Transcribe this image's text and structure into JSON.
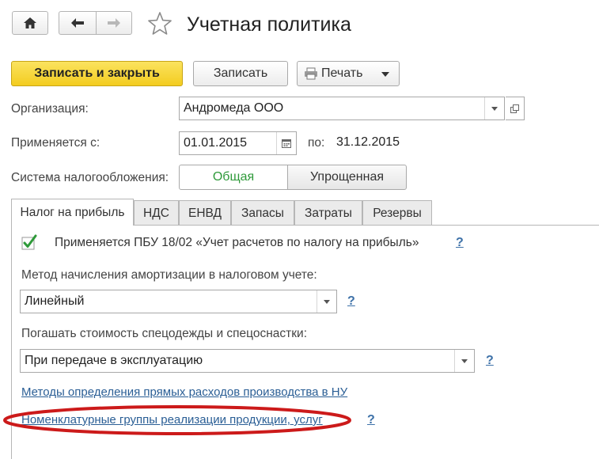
{
  "header": {
    "title": "Учетная политика"
  },
  "toolbar": {
    "save_close_label": "Записать и закрыть",
    "save_label": "Записать",
    "print_label": "Печать"
  },
  "form": {
    "org_label": "Организация:",
    "org_value": "Андромеда ООО",
    "applies_label": "Применяется с:",
    "date_from": "01.01.2015",
    "to_label": "по:",
    "date_to": "31.12.2015",
    "tax_system_label": "Система налогообложения:",
    "tax_options": [
      "Общая",
      "Упрощенная"
    ]
  },
  "tabs": [
    "Налог на прибыль",
    "НДС",
    "ЕНВД",
    "Запасы",
    "Затраты",
    "Резервы"
  ],
  "profit_tab": {
    "pbu_label": "Применяется ПБУ 18/02 «Учет расчетов по налогу на прибыль»",
    "help_mark": "?",
    "amort_label": "Метод начисления амортизации в налоговом учете:",
    "amort_value": "Линейный",
    "workwear_label": "Погашать стоимость спецодежды и спецоснастки:",
    "workwear_value": "При передаче в эксплуатацию",
    "direct_costs_link": "Методы определения прямых расходов производства в НУ",
    "nomenclature_link": "Номенклатурные группы реализации продукции, услуг"
  },
  "colors": {
    "primary_button": "#f3cc1f",
    "link": "#2a5e95",
    "checkbox_mark": "#2f9a3a",
    "active_toggle_text": "#2f9a3a",
    "highlight_ellipse": "#cc1a1a"
  }
}
